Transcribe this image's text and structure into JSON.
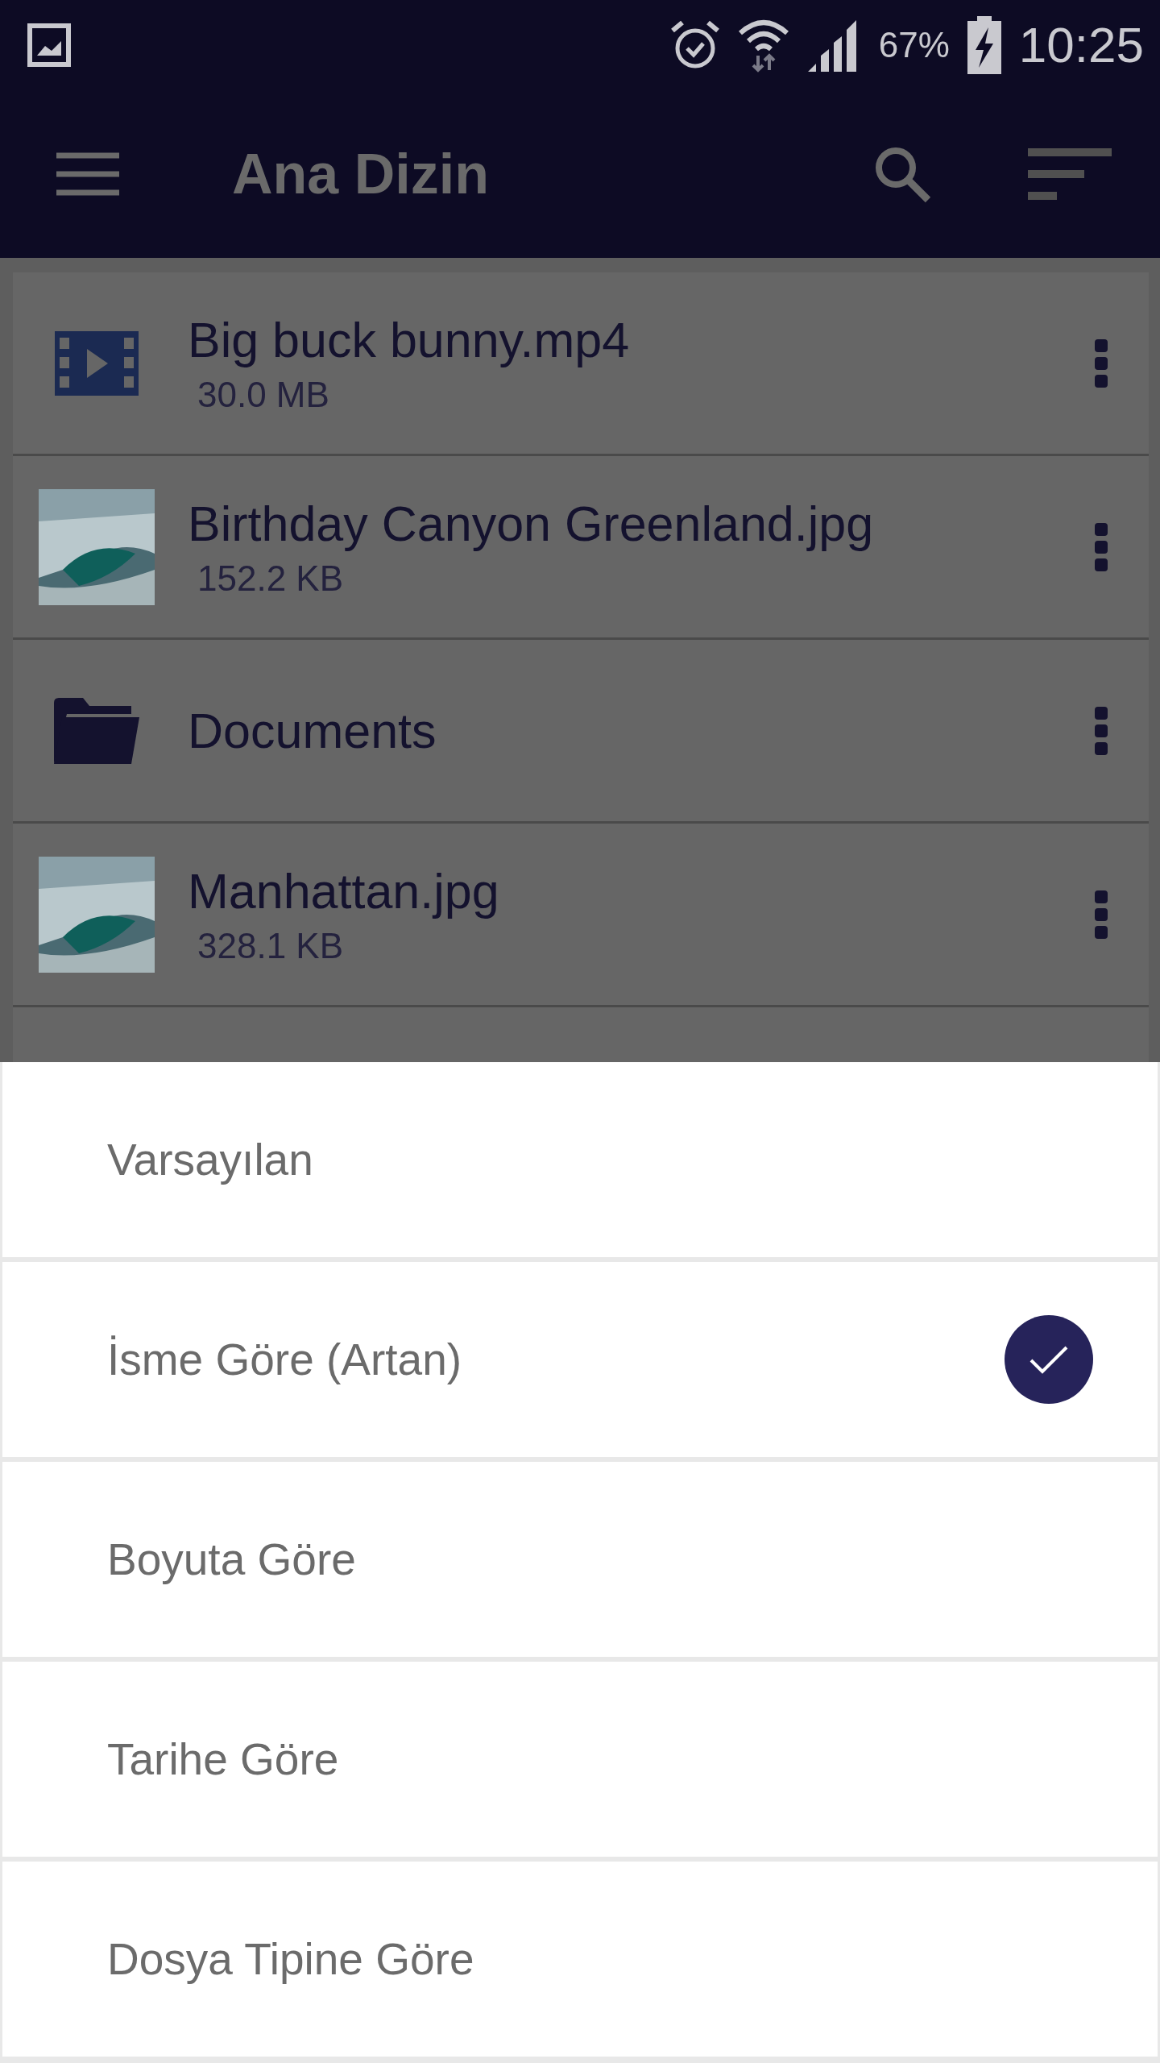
{
  "status_bar": {
    "battery": "67%",
    "time": "10:25"
  },
  "app_bar": {
    "title": "Ana Dizin"
  },
  "files": [
    {
      "kind": "video",
      "name": "Big buck bunny.mp4",
      "size": "30.0 MB"
    },
    {
      "name": "Birthday Canyon Greenland.jpg",
      "size": "152.2 KB"
    },
    {
      "kind": "folder",
      "name": "Documents"
    },
    {
      "name": "Manhattan.jpg",
      "size": "328.1 KB"
    }
  ],
  "sort_options": [
    {
      "label": "Varsayılan",
      "selected": false
    },
    {
      "label": "İsme Göre (Artan)",
      "selected": true
    },
    {
      "label": "Boyuta Göre",
      "selected": false
    },
    {
      "label": "Tarihe Göre",
      "selected": false
    },
    {
      "label": "Dosya Tipine Göre",
      "selected": false
    }
  ]
}
